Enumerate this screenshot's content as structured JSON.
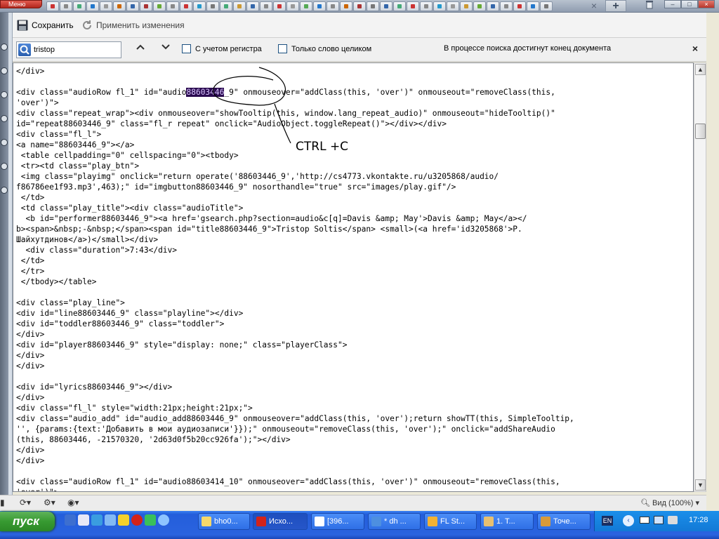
{
  "browser": {
    "menu_label": "Меню",
    "tab_close": "×",
    "tab_add": "+",
    "tab_count": 38
  },
  "toolbar": {
    "save_label": "Сохранить",
    "apply_label": "Применить изменения"
  },
  "findbar": {
    "query": "tristop",
    "match_case_label": "С учетом регистра",
    "whole_word_label": "Только слово целиком",
    "status": "В процессе поиска достигнут конец документа",
    "close": "×",
    "prev": "⌃",
    "next": "⌄"
  },
  "editor": {
    "highlighted_text": "88603446",
    "lines": [
      "</div>",
      "",
      "<div class=\"audioRow fl_1\" id=\"audio",
      "'over')\">",
      "<div class=\"repeat_wrap\"><div onmouseover=\"showTooltip(this, window.lang_repeat_audio)\" onmouseout=\"hideTooltip()\"",
      "id=\"repeat88603446_9\" class=\"fl_r repeat\" onclick=\"AudioObject.toggleRepeat()\"></div></div>",
      "<div class=\"fl_l\">",
      "<a name=\"88603446_9\"></a>",
      " <table cellpadding=\"0\" cellspacing=\"0\"><tbody>",
      " <tr><td class=\"play_btn\">",
      " <img class=\"playimg\" onclick=\"return operate('88603446_9','http://cs4773.vkontakte.ru/u3205868/audio/",
      "f86786ee1f93.mp3',463);\" id=\"imgbutton88603446_9\" nosorthandle=\"true\" src=\"images/play.gif\"/>",
      " </td>",
      " <td class=\"play_title\"><div class=\"audioTitle\">",
      "  <b id=\"performer88603446_9\"><a href='gsearch.php?section=audio&c[q]=Davis &amp; May'>Davis &amp; May</a></",
      "b><span>&nbsp;-&nbsp;</span><span id=\"title88603446_9\">Tristop Soltis</span> <small>(<a href='id3205868'>P.",
      "Шайхутдинов</a>)</small></div>",
      "  <div class=\"duration\">7:43</div>",
      " </td>",
      " </tr>",
      " </tbody></table>",
      "",
      "<div class=\"play_line\">",
      "<div id=\"line88603446_9\" class=\"playline\"></div>",
      "<div id=\"toddler88603446_9\" class=\"toddler\">",
      "</div>",
      "<div id=\"player88603446_9\" style=\"display: none;\" class=\"playerClass\">",
      "</div>",
      "</div>",
      "",
      "<div id=\"lyrics88603446_9\"></div>",
      "</div>",
      "<div class=\"fl_l\" style=\"width:21px;height:21px;\">",
      "<div class=\"audio_add\" id=\"audio_add88603446_9\" onmouseover=\"addClass(this, 'over');return showTT(this, SimpleTooltip,",
      "'', {params:{text:'Добавить в мои аудиозаписи'}});\" onmouseout=\"removeClass(this, 'over');\" onclick=\"addShareAudio",
      "(this, 88603446, -21570320, '2d63d0f5b20cc926fa');\"></div>",
      "</div>",
      "</div>",
      "",
      "<div class=\"audioRow fl_1\" id=\"audio88603414_10\" onmouseover=\"addClass(this, 'over')\" onmouseout=\"removeClass(this,",
      "'over')\">"
    ],
    "line2_after": "_9\" onmouseover=\"addClass(this, 'over')\" onmouseout=\"removeClass(this,",
    "annotation": "CTRL +C"
  },
  "statusbar": {
    "zoom": "Вид (100%)"
  },
  "taskbar": {
    "start_label": "пуск",
    "tasks": [
      "bho0...",
      "Исхо...",
      "[396...",
      "* dh ...",
      "FL St...",
      "1. T...",
      "Точе..."
    ],
    "lang": "EN",
    "clock": "17:28"
  },
  "colors": {
    "highlight_bg": "#2a0a4f",
    "highlight_fg": "#d9c5ff",
    "taskbar_blue": "#245edb",
    "start_green": "#379a31"
  }
}
